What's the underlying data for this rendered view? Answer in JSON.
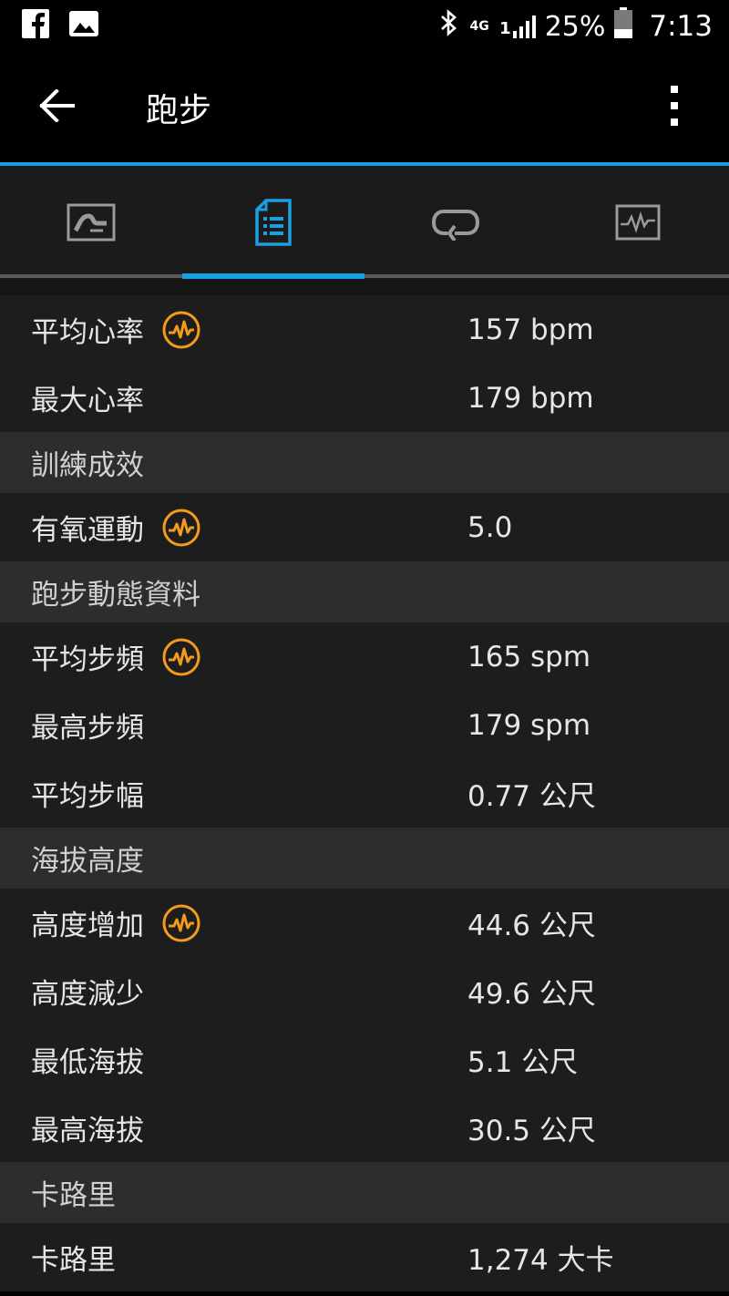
{
  "status_bar": {
    "network": "4G",
    "signal_prefix": "1",
    "battery": "25%",
    "time": "7:13"
  },
  "app_bar": {
    "title": "跑步"
  },
  "tabs": [
    {
      "icon": "map-icon",
      "selected": false
    },
    {
      "icon": "details-icon",
      "selected": true
    },
    {
      "icon": "laps-icon",
      "selected": false
    },
    {
      "icon": "chart-icon",
      "selected": false
    }
  ],
  "colors": {
    "accent": "#1a9fe0",
    "badge": "#f29b1d"
  },
  "rows": {
    "avg_hr": {
      "label": "平均心率",
      "value": "157 bpm"
    },
    "max_hr": {
      "label": "最大心率",
      "value": "179 bpm"
    },
    "training_header": "訓練成效",
    "aerobic": {
      "label": "有氧運動",
      "value": "5.0"
    },
    "dynamics_header": "跑步動態資料",
    "avg_cadence": {
      "label": "平均步頻",
      "value": "165 spm"
    },
    "max_cadence": {
      "label": "最高步頻",
      "value": "179 spm"
    },
    "avg_stride": {
      "label": "平均步幅",
      "value": "0.77 公尺"
    },
    "elevation_header": "海拔高度",
    "gain": {
      "label": "高度增加",
      "value": "44.6 公尺"
    },
    "loss": {
      "label": "高度減少",
      "value": "49.6 公尺"
    },
    "min_elev": {
      "label": "最低海拔",
      "value": "5.1 公尺"
    },
    "max_elev": {
      "label": "最高海拔",
      "value": "30.5 公尺"
    },
    "calories_header": "卡路里",
    "calories": {
      "label": "卡路里",
      "value": "1,274 大卡"
    }
  }
}
